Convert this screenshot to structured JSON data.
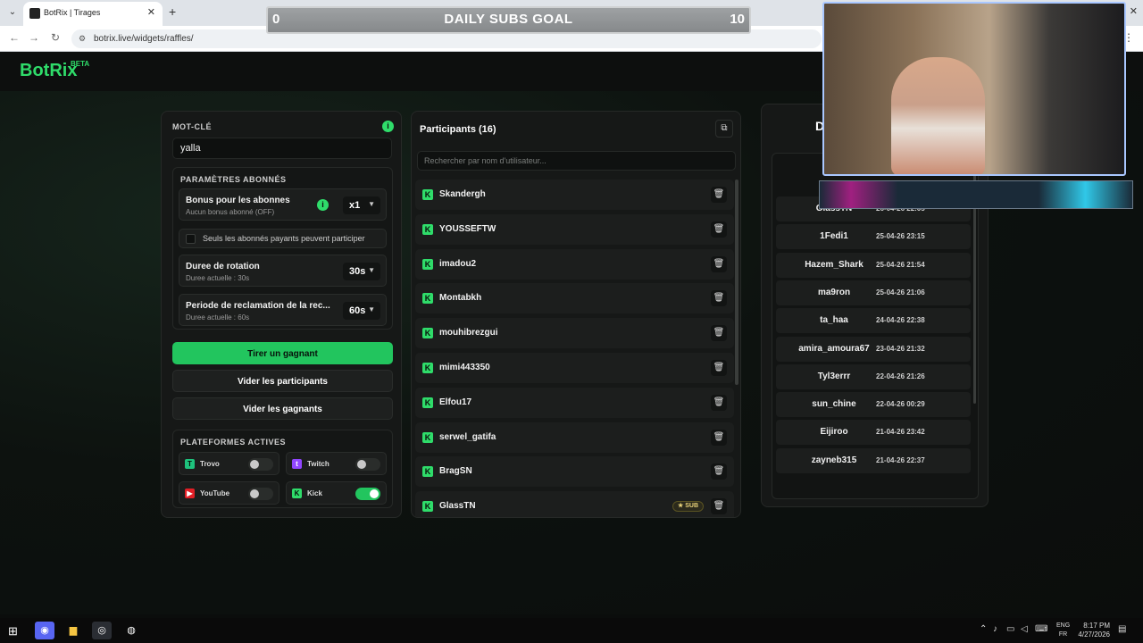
{
  "browser": {
    "tab_title": "BotRix | Tirages",
    "url": "botrix.live/widgets/raffles/"
  },
  "brand": {
    "name": "BotRix",
    "badge": "BETA",
    "accent": "#22c55e"
  },
  "settings": {
    "keyword_label": "MOT-CLÉ",
    "keyword_value": "yalla",
    "subs_section_title": "PARAMÈTRES ABONNÉS",
    "bonus_title": "Bonus pour les abonnes",
    "bonus_sub": "Aucun bonus abonné (OFF)",
    "bonus_value": "x1",
    "only_paid_label": "Seuls les abonnés payants peuvent participer",
    "rotation_title": "Duree de rotation",
    "rotation_sub": "Duree actuelle : 30s",
    "rotation_value": "30s",
    "claim_title": "Periode de reclamation de la rec...",
    "claim_sub": "Duree actuelle : 60s",
    "claim_value": "60s",
    "draw_button": "Tirer un gagnant",
    "clear_participants_button": "Vider les participants",
    "clear_winners_button": "Vider les gagnants",
    "platforms_title": "PLATEFORMES ACTIVES",
    "platforms": [
      {
        "name": "Trovo",
        "enabled": false
      },
      {
        "name": "Twitch",
        "enabled": false
      },
      {
        "name": "YouTube",
        "enabled": false
      },
      {
        "name": "Kick",
        "enabled": true
      }
    ]
  },
  "participants": {
    "title": "Participants (16)",
    "search_placeholder": "Rechercher par nom d'utilisateur...",
    "items": [
      {
        "name": "Skandergh"
      },
      {
        "name": "YOUSSEFTW"
      },
      {
        "name": "imadou2"
      },
      {
        "name": "Montabkh"
      },
      {
        "name": "mouhibrezgui"
      },
      {
        "name": "mimi443350"
      },
      {
        "name": "Elfou17"
      },
      {
        "name": "serwel_gatifa"
      },
      {
        "name": "BragSN"
      },
      {
        "name": "GlassTN",
        "badge": "SUB"
      }
    ]
  },
  "winners": {
    "title_partial": "D",
    "items": [
      {
        "name": "GlassTN",
        "date": "26-04-26 22:05"
      },
      {
        "name": "1Fedi1",
        "date": "25-04-26 23:15"
      },
      {
        "name": "Hazem_Shark",
        "date": "25-04-26 21:54"
      },
      {
        "name": "ma9ron",
        "date": "25-04-26 21:06"
      },
      {
        "name": "ta_haa",
        "date": "24-04-26 22:38"
      },
      {
        "name": "amira_amoura67",
        "date": "23-04-26 21:32"
      },
      {
        "name": "Tyl3errr",
        "date": "22-04-26 21:26"
      },
      {
        "name": "sun_chine",
        "date": "22-04-26 00:29"
      },
      {
        "name": "Eijiroo",
        "date": "21-04-26 23:42"
      },
      {
        "name": "zayneb315",
        "date": "21-04-26 22:37"
      }
    ]
  },
  "overlay_goal": {
    "current": "0",
    "title": "DAILY SUBS GOAL",
    "target": "10"
  },
  "taskbar": {
    "lang_top": "ENG",
    "lang_bottom": "FR",
    "time": "8:17 PM",
    "date": "4/27/2026"
  }
}
